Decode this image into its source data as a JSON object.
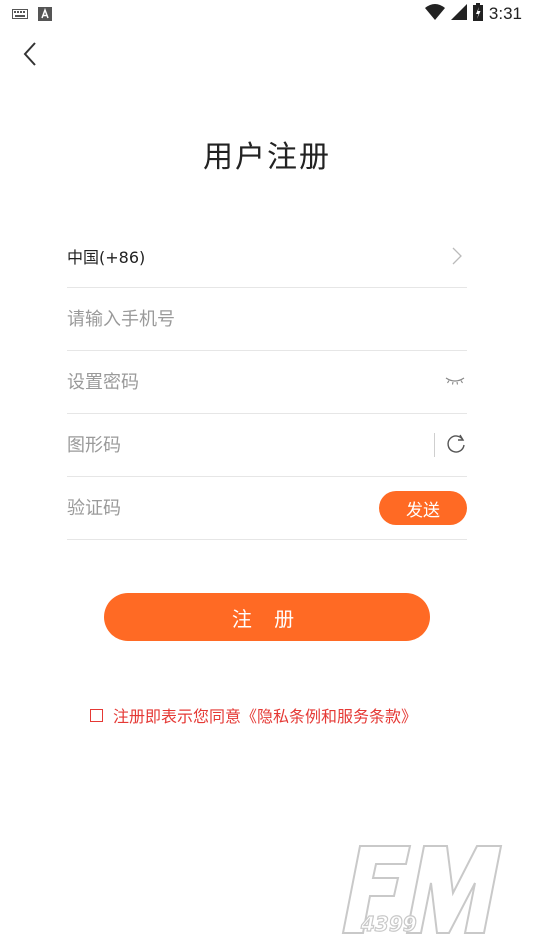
{
  "status_bar": {
    "time": "3:31",
    "icons": [
      "keyboard-icon",
      "a-icon",
      "wifi-icon",
      "signal-icon",
      "battery-icon"
    ]
  },
  "nav": {
    "back_icon": "chevron-left-icon"
  },
  "page": {
    "title": "用户注册"
  },
  "form": {
    "country_code": "中国(+86)",
    "phone_placeholder": "请输入手机号",
    "password_placeholder": "设置密码",
    "captcha_placeholder": "图形码",
    "sms_placeholder": "验证码",
    "send_label": "发送"
  },
  "actions": {
    "register_label": "注 册"
  },
  "agreement": {
    "text": "注册即表示您同意《隐私条例和服务条款》"
  },
  "colors": {
    "accent": "#ff6a24",
    "agreement": "#e53935"
  },
  "watermark": {
    "brand": "FM 4399"
  }
}
